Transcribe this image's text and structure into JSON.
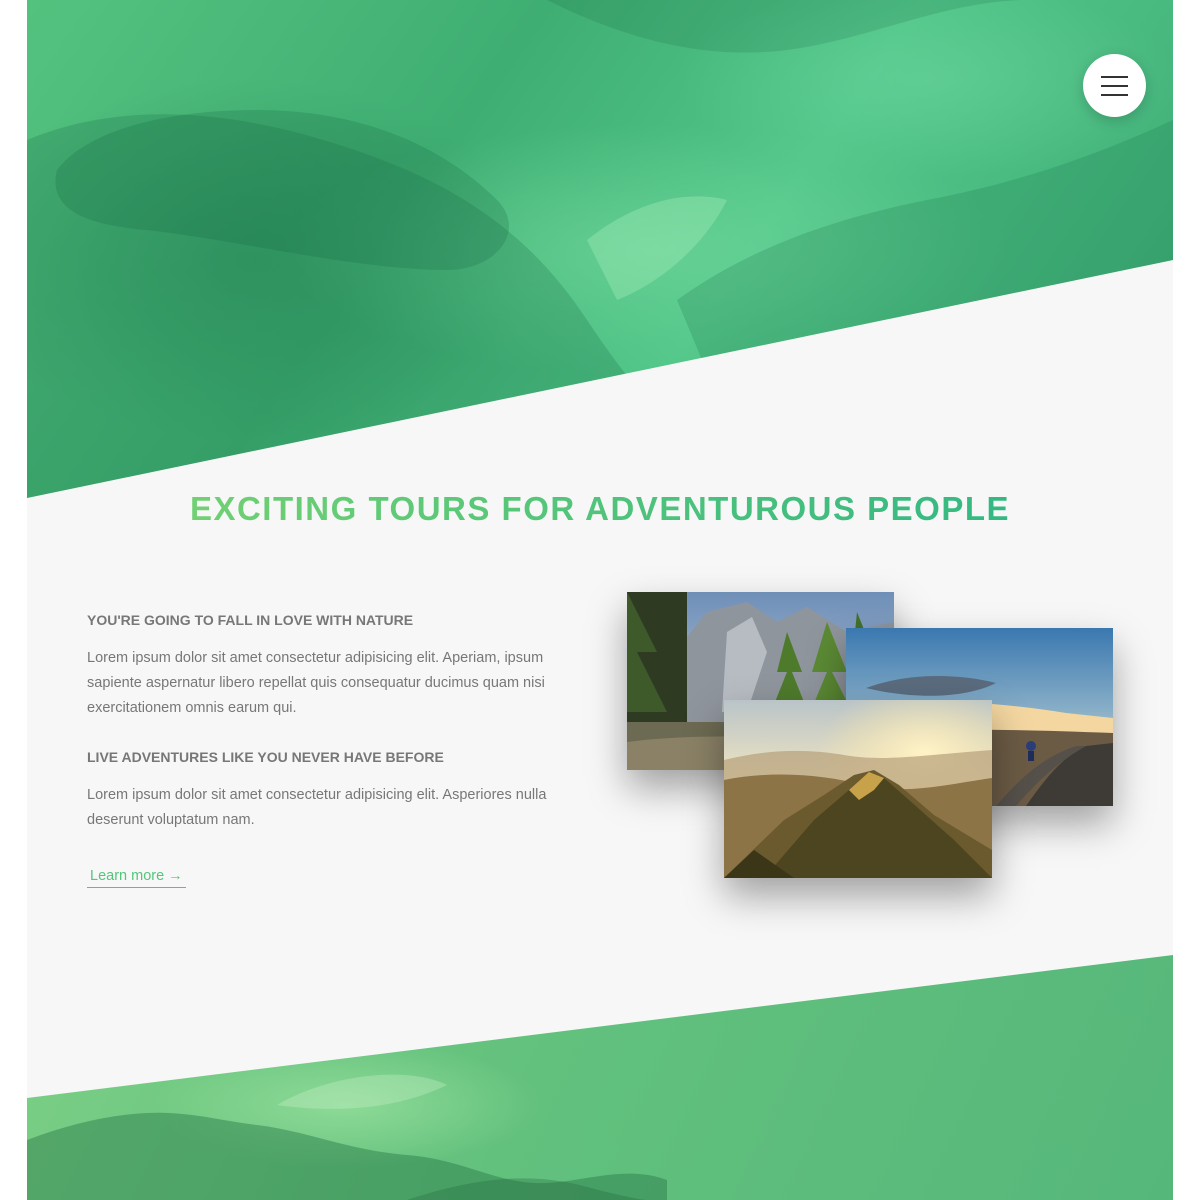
{
  "menu": {
    "icon": "hamburger-menu-icon"
  },
  "heading": "EXCITING TOURS FOR ADVENTUROUS PEOPLE",
  "features": [
    {
      "title": "YOU'RE GOING TO FALL IN LOVE WITH NATURE",
      "text": "Lorem ipsum dolor sit amet consectetur adipisicing elit. Aperiam, ipsum sapiente aspernatur libero repellat quis consequatur ducimus quam nisi exercitationem omnis earum qui."
    },
    {
      "title": "LIVE ADVENTURES LIKE YOU NEVER HAVE BEFORE",
      "text": "Lorem ipsum dolor sit amet consectetur adipisicing elit. Asperiores nulla deserunt voluptatum nam."
    }
  ],
  "learn_more": "Learn more →",
  "colors": {
    "primary": "#55c57a",
    "primary_light": "#7ed56f",
    "primary_dark": "#28b485",
    "text": "#777777",
    "background": "#f7f7f7"
  }
}
